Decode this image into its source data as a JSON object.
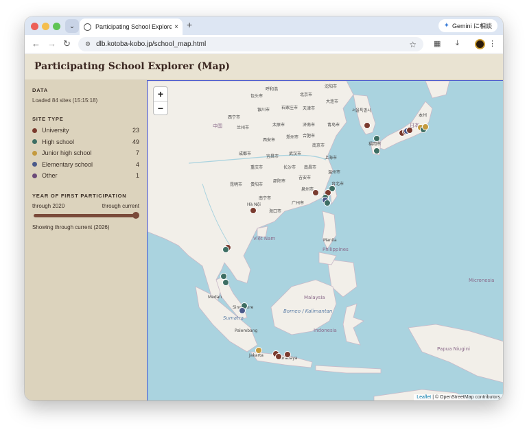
{
  "browser": {
    "tab_title": "Participating School Explorer",
    "tab_close": "×",
    "new_tab": "+",
    "gemini_label": "Gemini に相談",
    "url": "dlb.kotoba-kobo.jp/school_map.html"
  },
  "page": {
    "title": "Participating School Explorer (Map)"
  },
  "sidebar": {
    "data_heading": "DATA",
    "loaded_text": "Loaded 84 sites (15:15:18)",
    "site_type_heading": "SITE TYPE",
    "site_types": [
      {
        "label": "University",
        "count": "23",
        "color": "#7a3b2e"
      },
      {
        "label": "High school",
        "count": "49",
        "color": "#3d6e63"
      },
      {
        "label": "Junior high school",
        "count": "7",
        "color": "#c49a3e"
      },
      {
        "label": "Elementary school",
        "count": "4",
        "color": "#4b5a8a"
      },
      {
        "label": "Other",
        "count": "1",
        "color": "#6b4a78"
      }
    ],
    "year_heading": "YEAR OF FIRST PARTICIPATION",
    "slider_min_label": "through 2020",
    "slider_max_label": "through current",
    "slider_value": 1.0,
    "showing_text": "Showing through current (2026)"
  },
  "map": {
    "zoom_in": "+",
    "zoom_out": "−",
    "attribution_leaflet": "Leaflet",
    "attribution_rest": " | © OpenStreetMap contributors",
    "labels": {
      "china": "中国",
      "japan": "日本",
      "vietnam": "Việt Nam",
      "philippines": "Philippines",
      "manila": "Manila",
      "malaysia": "Malaysia",
      "indonesia": "Indonesia",
      "medan": "Medan",
      "singapore": "Singapore",
      "sumatra": "Sumatra",
      "palembang": "Palembang",
      "jakarta": "Jakarta",
      "surabaya": "Surabaya",
      "borneo": "Borneo / Kalimantan",
      "papua": "Papua Niugini",
      "micronesia": "Micronesia",
      "hanoi": "Hà Nội",
      "shanghai": "上海市",
      "beijing": "北京市",
      "fukuoka": "福岡市",
      "seoul": "서울특별시",
      "guangzhou": "广州市",
      "chongqing": "重庆市",
      "wuhan": "武汉市",
      "chengdu": "成都市",
      "xian": "西安市",
      "lanzhou": "兰州市",
      "xining": "西宁市",
      "kunming": "昆明市",
      "nanning": "南宁市",
      "haikou": "海口市",
      "taipei": "台北市",
      "tianjin": "天津市",
      "dalian": "大连市",
      "qingdao": "青岛市",
      "shenyang": "沈阳市",
      "nanjing": "南京市",
      "zhengzhou": "郑州市",
      "jinan": "济南市",
      "hefei": "合肥市",
      "changsha": "长沙市",
      "nanchang": "南昌市",
      "guiyang": "贵阳市",
      "xiamen": "泉州市",
      "wenzhou": "温州市",
      "huhehaote": "呼和浩",
      "baotou": "包头市",
      "yinchuan": "银川市",
      "taiyuan": "太原市",
      "shijiazhuang": "石家庄市",
      "yichang": "宜昌市",
      "shaoyang": "邵阳市",
      "jian": "吉安市",
      "honshu": "本州"
    },
    "markers": [
      {
        "type": "University",
        "color": "#7a3b2e"
      },
      {
        "type": "High school",
        "color": "#3d6e63"
      },
      {
        "type": "Junior high school",
        "color": "#c49a3e"
      },
      {
        "type": "Elementary school",
        "color": "#4b5a8a"
      }
    ]
  }
}
